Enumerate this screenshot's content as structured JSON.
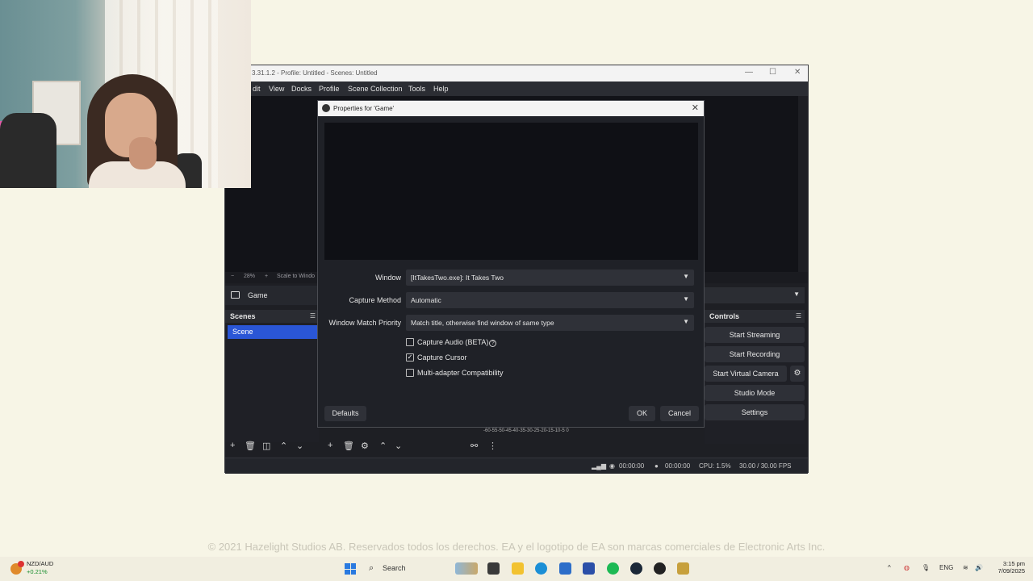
{
  "obs": {
    "title": "3.31.1.2 - Profile: Untitled - Scenes: Untitled",
    "menu": [
      "dit",
      "View",
      "Docks",
      "Profile",
      "Scene Collection",
      "Tools",
      "Help"
    ],
    "preview_strip": {
      "minus": "−",
      "zoom": "28%",
      "plus": "+",
      "scale": "Scale to Windo"
    },
    "source_name": "Game",
    "scenes_title": "Scenes",
    "scene_item": "Scene",
    "controls_title": "Controls",
    "controls": {
      "start_streaming": "Start Streaming",
      "start_recording": "Start Recording",
      "start_virtual_camera": "Start Virtual Camera",
      "studio_mode": "Studio Mode",
      "settings": "Settings"
    },
    "mixer_scale": "-60-55-50-45-40-35-30-25-20-15-10-5 0",
    "status": {
      "stream_time": "00:00:00",
      "record_time": "00:00:00",
      "cpu": "CPU: 1.5%",
      "fps": "30.00 / 30.00 FPS"
    }
  },
  "dialog": {
    "title": "Properties for 'Game'",
    "window_label": "Window",
    "window_value": "[ItTakesTwo.exe]: It Takes Two",
    "capture_method_label": "Capture Method",
    "capture_method_value": "Automatic",
    "match_priority_label": "Window Match Priority",
    "match_priority_value": "Match title, otherwise find window of same type",
    "checks": {
      "capture_audio": "Capture Audio (BETA)",
      "capture_cursor": "Capture Cursor",
      "multi_adapter": "Multi-adapter Compatibility"
    },
    "defaults": "Defaults",
    "ok": "OK",
    "cancel": "Cancel"
  },
  "copyright": "© 2021 Hazelight Studios AB. Reservados todos los derechos. EA y el logotipo de EA son marcas comerciales de Electronic Arts Inc.",
  "taskbar": {
    "ticker_name": "NZD/AUD",
    "ticker_change": "+0.21%",
    "search": "Search",
    "lang": "ENG",
    "time": "3:15 pm",
    "date": "7/09/2025"
  }
}
